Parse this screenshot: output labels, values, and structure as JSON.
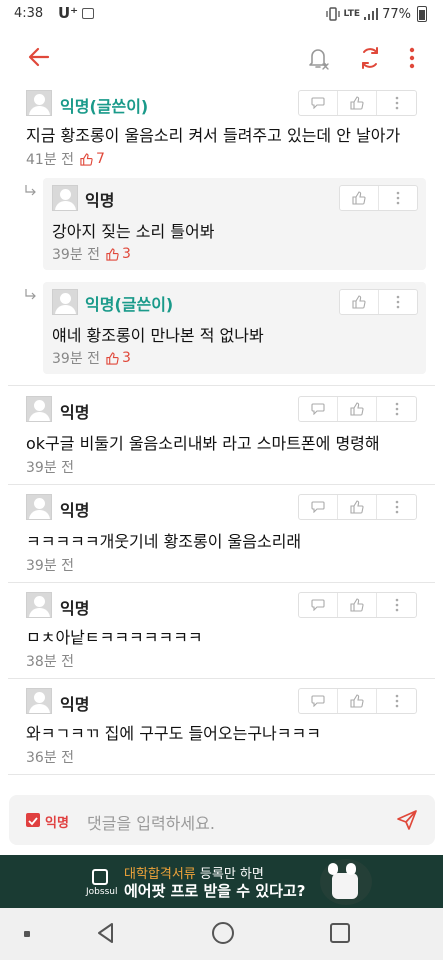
{
  "status_bar": {
    "time": "4:38",
    "carrier": "U⁺",
    "lte_label": "LTE",
    "battery": "77%"
  },
  "app_bar": {
    "back_icon": "arrow-left-icon",
    "bell_icon": "bell-off-icon",
    "refresh_icon": "refresh-icon",
    "more_icon": "more-vertical-icon",
    "accent_color": "#e0483a"
  },
  "comments": [
    {
      "author": "익명(글쓴이)",
      "is_op": true,
      "body": "지금 황조롱이 울음소리 켜서 들려주고 있는데 안 날아가",
      "time": "41분 전",
      "likes": "7",
      "reply": false
    },
    {
      "author": "익명",
      "is_op": false,
      "body": "강아지 짖는 소리 틀어봐",
      "time": "39분 전",
      "likes": "3",
      "reply": true
    },
    {
      "author": "익명(글쓴이)",
      "is_op": true,
      "body": "얘네 황조롱이 만나본 적 없나봐",
      "time": "39분 전",
      "likes": "3",
      "reply": true
    },
    {
      "author": "익명",
      "is_op": false,
      "body": "ok구글 비둘기 울음소리내봐 라고 스마트폰에 명령해",
      "time": "39분 전",
      "likes": "",
      "reply": false
    },
    {
      "author": "익명",
      "is_op": false,
      "body": "ㅋㅋㅋㅋㅋ개웃기네 황조롱이 울음소리래",
      "time": "39분 전",
      "likes": "",
      "reply": false
    },
    {
      "author": "익명",
      "is_op": false,
      "body": "ㅁㅊ아낱ㅌㅋㅋㅋㅋㅋㅋㅋ",
      "time": "38분 전",
      "likes": "",
      "reply": false
    },
    {
      "author": "익명",
      "is_op": false,
      "body": "와ㅋㄱㅋㄲ 집에 구구도 들어오는구나ㅋㅋㅋ",
      "time": "36분 전",
      "likes": "",
      "reply": false
    }
  ],
  "input_bar": {
    "anonymous_label": "익명",
    "placeholder": "댓글을 입력하세요."
  },
  "ad": {
    "logo_text": "Jobssul",
    "line1_highlight": "대학합격서류",
    "line1_rest": " 등록만 하면",
    "line2": "에어팟 프로 받을 수 있다고?"
  }
}
